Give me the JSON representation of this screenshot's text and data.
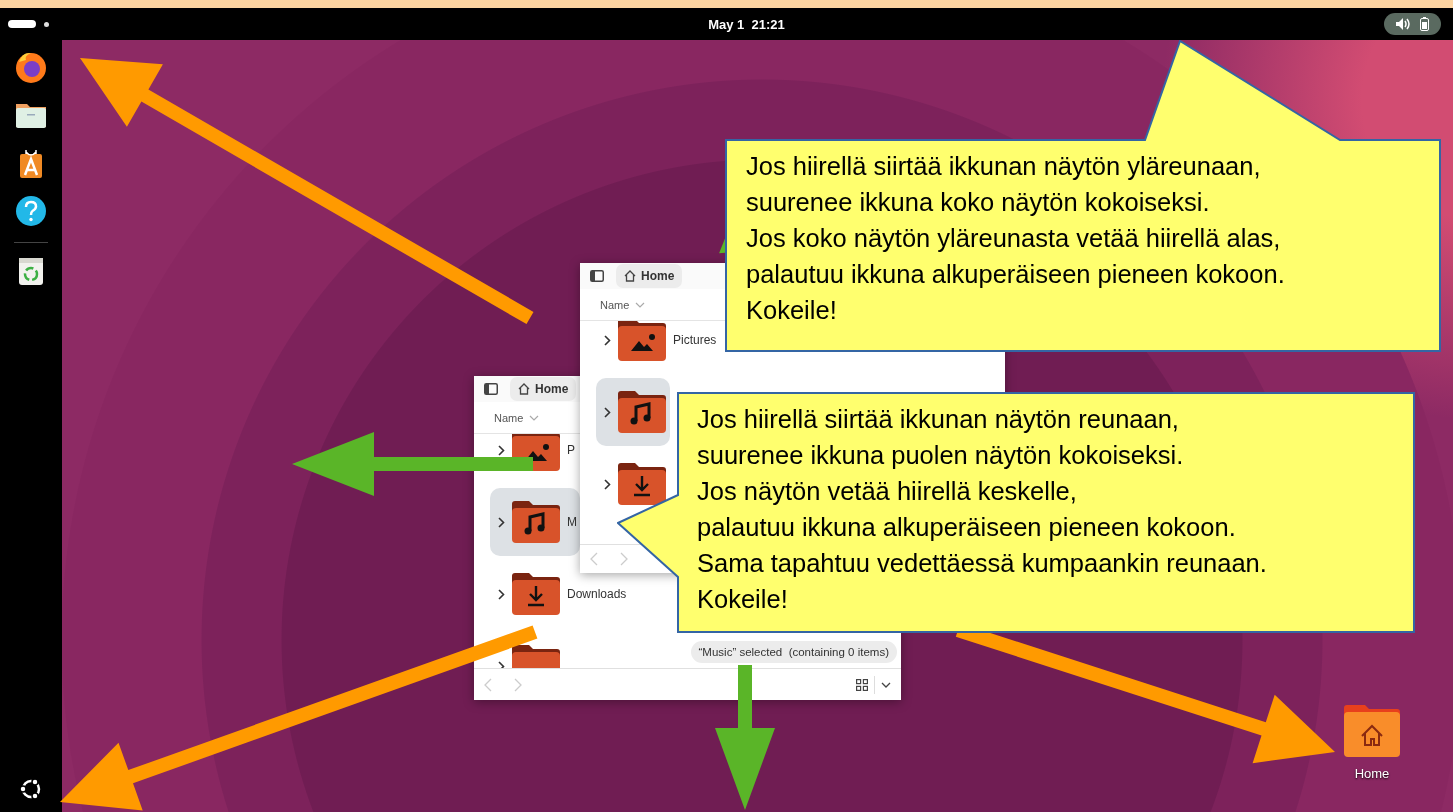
{
  "top_bar": {
    "clock": "May 1  21:21"
  },
  "windows": [
    {
      "tab": "Home",
      "column": "Name",
      "rows": [
        {
          "kind": "pictures",
          "label": "P",
          "selected": false
        },
        {
          "kind": "music",
          "label": "M",
          "selected": true
        },
        {
          "kind": "downloads",
          "label": "Downloads",
          "selected": false
        },
        {
          "kind": "folder",
          "selected": false
        }
      ],
      "status": "“Music” selected  (containing 0 items)"
    },
    {
      "tab": "Home",
      "column": "Name",
      "rows": [
        {
          "kind": "pictures",
          "label": "Pictures",
          "selected": false
        },
        {
          "kind": "music",
          "selected": true
        },
        {
          "kind": "downloads",
          "selected": false
        }
      ]
    }
  ],
  "desktop_icons": [
    {
      "label": "Home"
    }
  ],
  "callouts": [
    {
      "lines": [
        "Jos hiirellä siirtää ikkunan näytön yläreunaan,",
        "suurenee ikkuna koko näytön kokoiseksi.",
        "Jos koko näytön yläreunasta vetää hiirellä alas,",
        "palautuu ikkuna alkuperäiseen pieneen kokoon.",
        "Kokeile!"
      ]
    },
    {
      "lines": [
        "Jos hiirellä siirtää ikkunan näytön reunaan,",
        "suurenee ikkuna puolen näytön kokoiseksi.",
        "Jos näytön vetää hiirellä keskelle,",
        "palautuu ikkuna alkuperäiseen pieneen kokoon.",
        "Sama tapahtuu vedettäessä kumpaankin reunaan.",
        "Kokeile!"
      ]
    }
  ]
}
